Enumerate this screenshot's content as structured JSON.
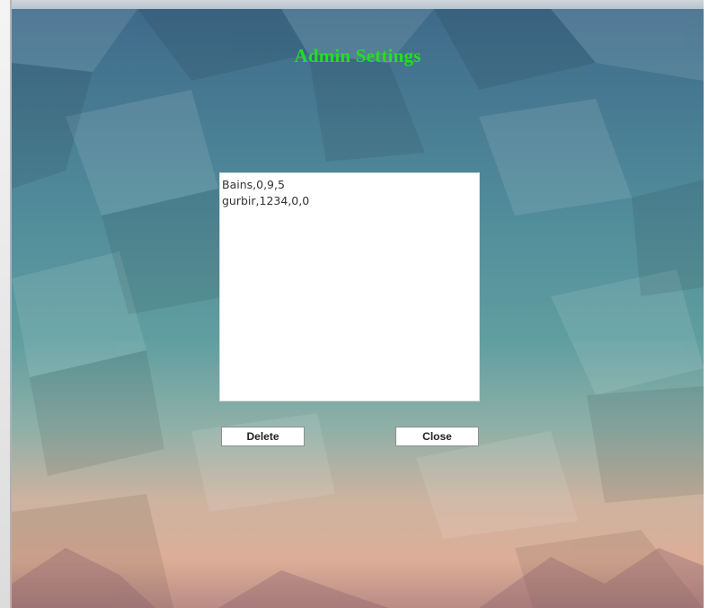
{
  "window": {
    "title": "Admin Settings"
  },
  "list": {
    "items": [
      {
        "label": "Bains,0,9,5"
      },
      {
        "label": "gurbir,1234,0,0"
      }
    ]
  },
  "buttons": {
    "delete_label": "Delete",
    "close_label": "Close"
  },
  "colors": {
    "title": "#22e01e",
    "background_top": "#3e6a8a",
    "background_middle": "#5f9ea0",
    "background_bottom": "#d6a994"
  }
}
